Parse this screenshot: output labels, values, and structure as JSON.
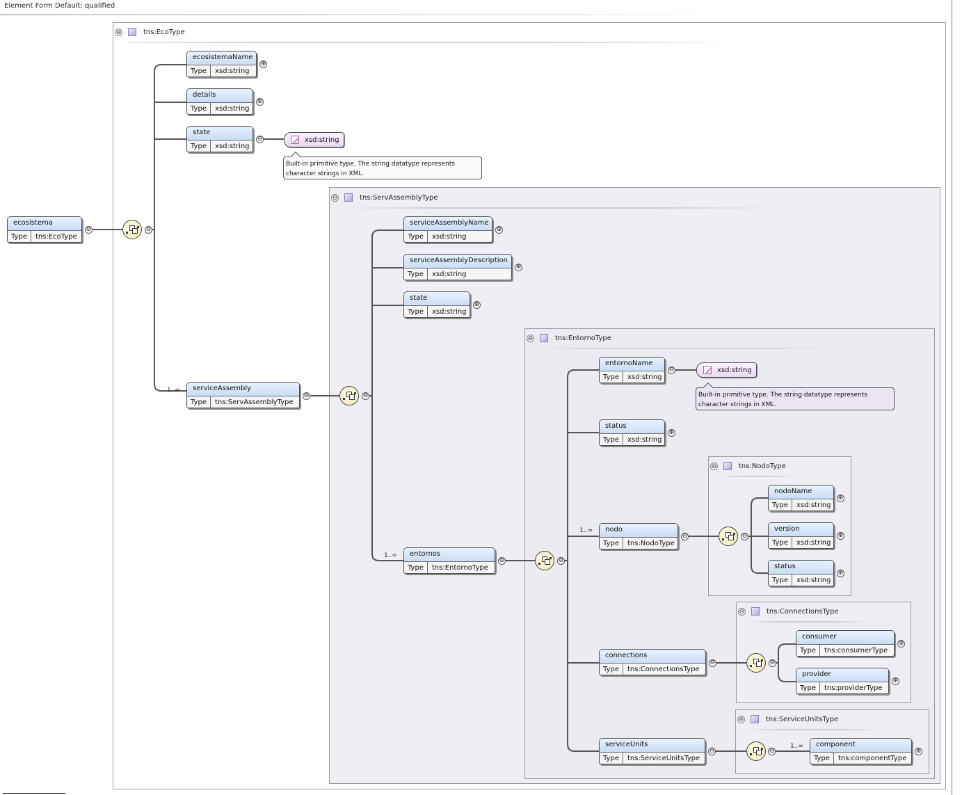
{
  "header": {
    "label": "Element Form Default: qualified"
  },
  "ui": {
    "expanded": "⊖",
    "collapsed": "⊕",
    "type_key": "Type",
    "unbounded": "1..∞"
  },
  "frames": {
    "eco": "tns:EcoType",
    "servassembly": "tns:ServAssemblyType",
    "entorno": "tns:EntornoType",
    "nodo": "tns:NodoType",
    "connections": "tns:ConnectionsType",
    "serviceunits": "tns:ServiceUnitsType"
  },
  "elements": {
    "ecosistema": {
      "name": "ecosistema",
      "type": "tns:EcoType"
    },
    "ecosistemaName": {
      "name": "ecosistemaName",
      "type": "xsd:string"
    },
    "details": {
      "name": "details",
      "type": "xsd:string"
    },
    "state1": {
      "name": "state",
      "type": "xsd:string"
    },
    "serviceAssembly": {
      "name": "serviceAssembly",
      "type": "tns:ServAssemblyType"
    },
    "serviceAssemblyName": {
      "name": "serviceAssemblyName",
      "type": "xsd:string"
    },
    "serviceAssemblyDescription": {
      "name": "serviceAssemblyDescription",
      "type": "xsd:string"
    },
    "state2": {
      "name": "state",
      "type": "xsd:string"
    },
    "entornos": {
      "name": "entornos",
      "type": "tns:EntornoType"
    },
    "entornoName": {
      "name": "entornoName",
      "type": "xsd:string"
    },
    "status1": {
      "name": "status",
      "type": "xsd:string"
    },
    "nodo": {
      "name": "nodo",
      "type": "tns:NodoType"
    },
    "nodoName": {
      "name": "nodoName",
      "type": "xsd:string"
    },
    "version": {
      "name": "version",
      "type": "xsd:string"
    },
    "status2": {
      "name": "status",
      "type": "xsd:string"
    },
    "connections": {
      "name": "connections",
      "type": "tns:ConnectionsType"
    },
    "consumer": {
      "name": "consumer",
      "type": "tns:consumerType"
    },
    "provider": {
      "name": "provider",
      "type": "tns:providerType"
    },
    "serviceUnits": {
      "name": "serviceUnits",
      "type": "tns:ServiceUnitsType"
    },
    "component": {
      "name": "component",
      "type": "tns:componentType"
    }
  },
  "simple_types": {
    "string1": "xsd:string",
    "string2": "xsd:string"
  },
  "annotations": {
    "string1": "Built-in primitive type. The string datatype represents character strings in XML.",
    "string2": "Built-in primitive type. The string datatype represents character strings in XML."
  },
  "colors": {
    "element_header_top": "#e9f2fd",
    "element_header_bottom": "#c9ddf5",
    "nested_frame_bg": "#f0eef5",
    "sequence_fill": "#f3e9b6",
    "simple_type_fill": "#eadaf4",
    "connector": "#555555"
  },
  "icons": [
    "collapse-icon",
    "expand-icon",
    "type-icon",
    "sequence-icon",
    "simple-type-icon"
  ]
}
